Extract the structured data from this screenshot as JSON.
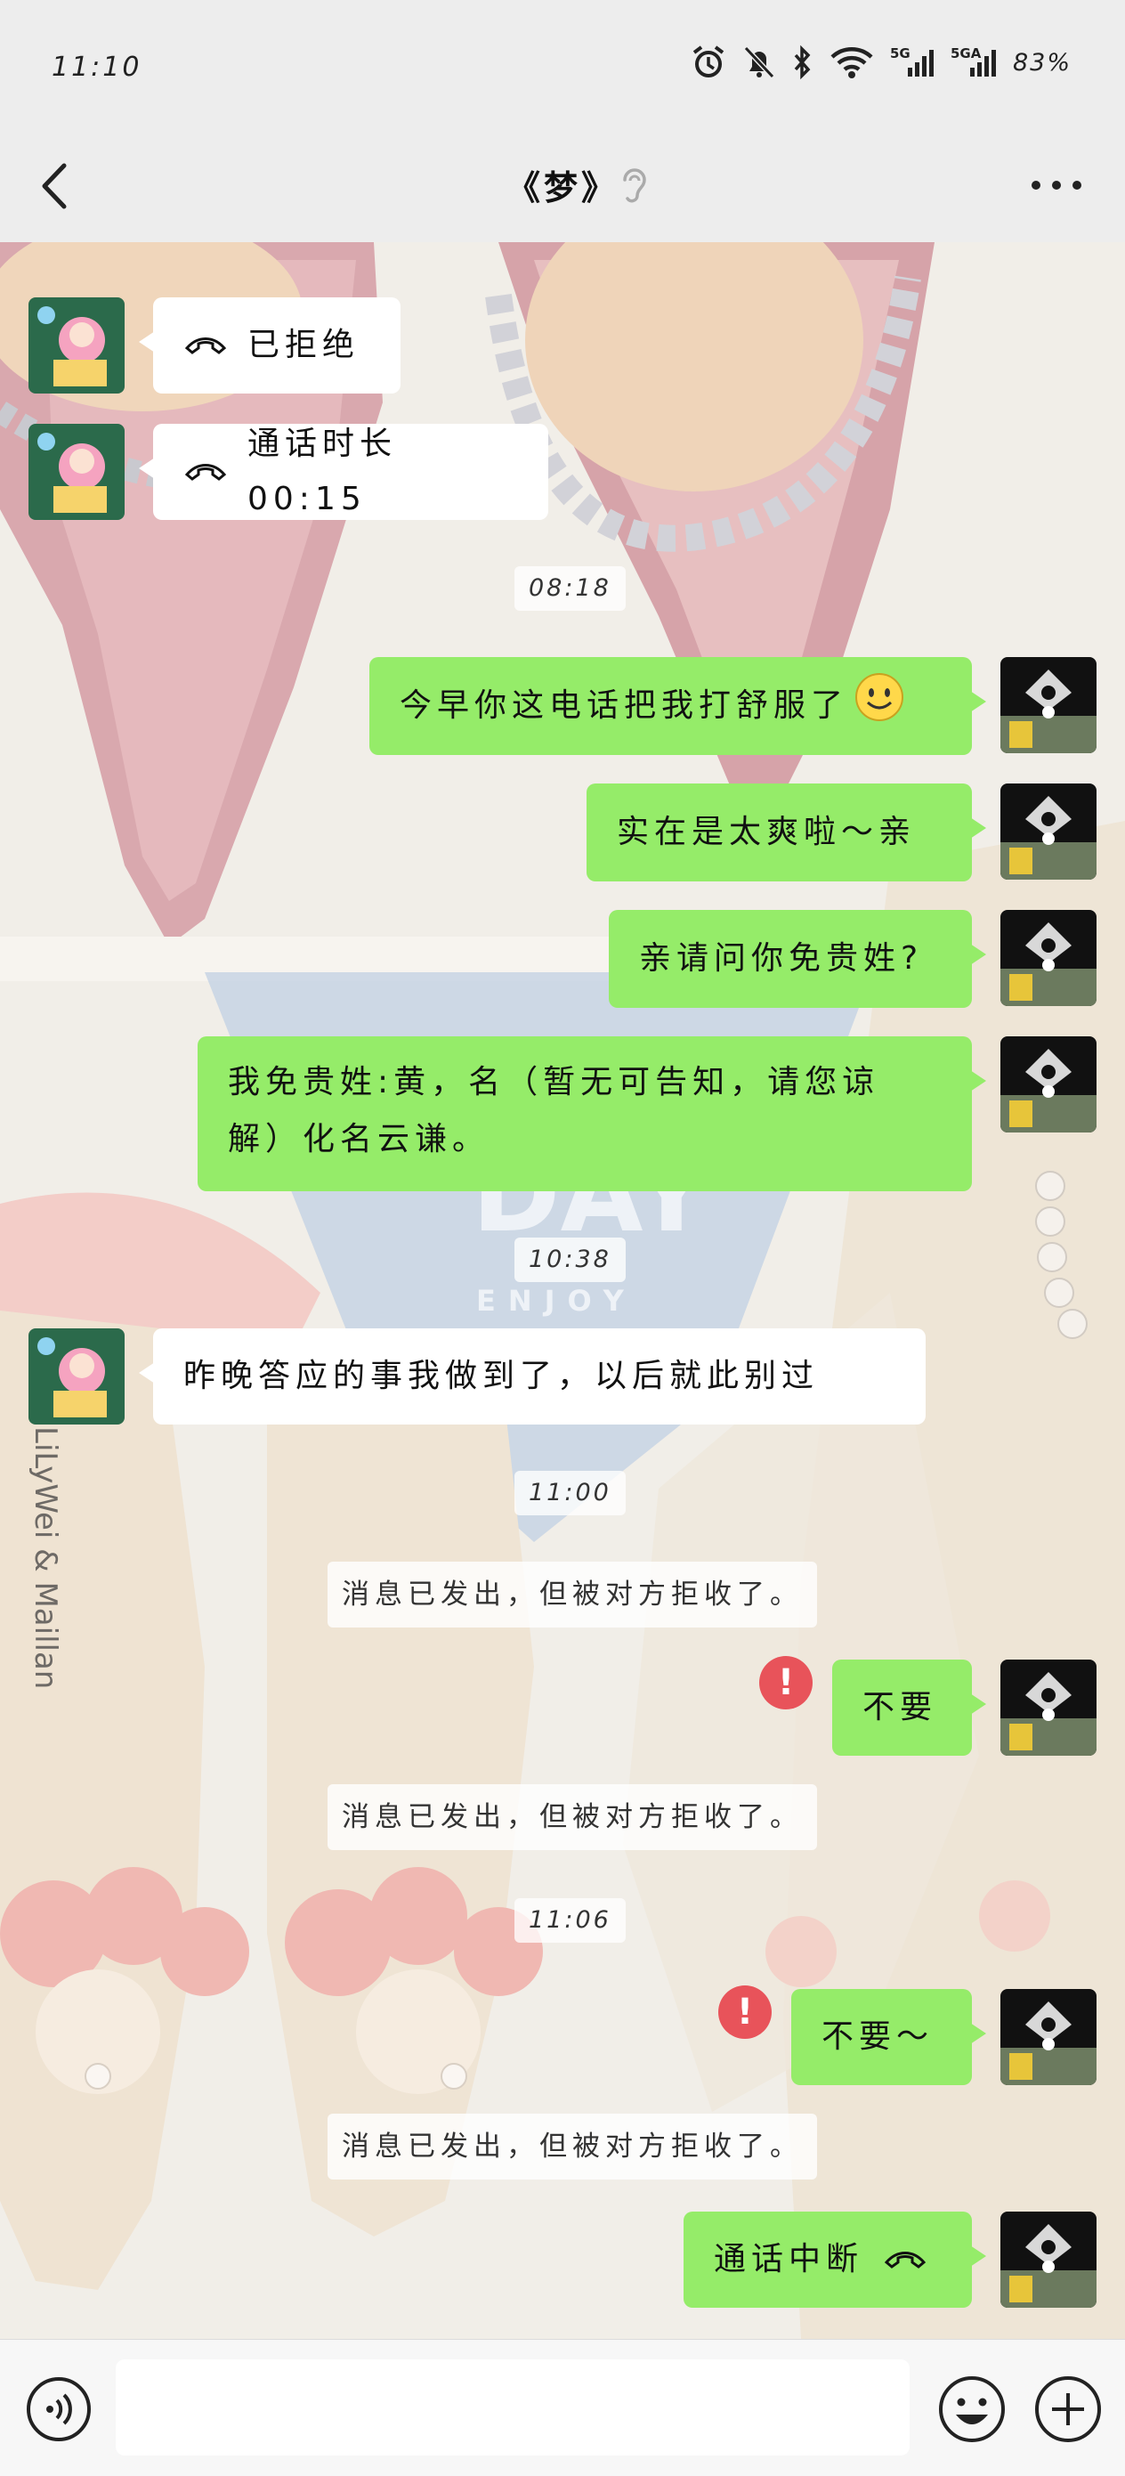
{
  "status_bar": {
    "time": "11:10",
    "battery": "83%",
    "net1": "5G",
    "net2": "5GA"
  },
  "nav": {
    "title": "《梦》"
  },
  "messages": {
    "m1": "已拒绝",
    "m2": "通话时长 00:15",
    "t1": "08:18",
    "m3": "今早你这电话把我打舒服了",
    "m4": "实在是太爽啦～亲",
    "m5": "亲请问你免贵姓?",
    "m6_line1": "我免贵姓:黄，名（暂无可告知，请您谅",
    "m6_line2": "解）化名云谦。",
    "t2": "10:38",
    "m7": "昨晚答应的事我做到了，以后就此别过",
    "t3": "11:00",
    "sys1": "消息已发出，但被对方拒收了。",
    "m8": "不要",
    "sys2": "消息已发出，但被对方拒收了。",
    "t4": "11:06",
    "m9": "不要～",
    "sys3": "消息已发出，但被对方拒收了。",
    "m10": "通话中断"
  },
  "background_text": {
    "enjoy": "ENJOY",
    "day": "DAY",
    "brand": "LiLyWei & Maillan"
  },
  "error_mark": "!",
  "colors": {
    "self_bubble": "#95ec69",
    "other_bubble": "#ffffff",
    "error": "#e8535a",
    "page_bg": "#ededed"
  }
}
